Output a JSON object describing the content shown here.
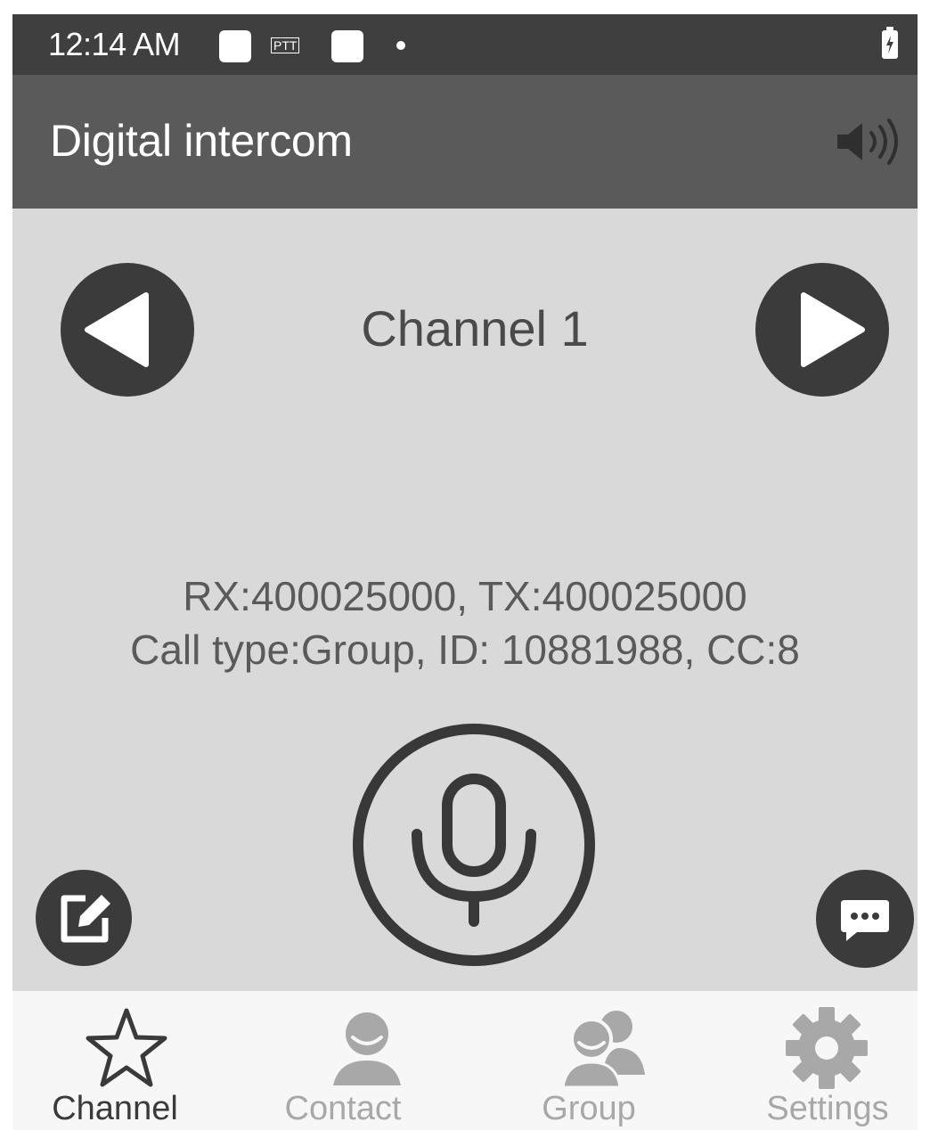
{
  "status_bar": {
    "time": "12:14 AM",
    "ptt_label": "PTT"
  },
  "app_bar": {
    "title": "Digital intercom",
    "volume_icon": "volume-icon"
  },
  "channel": {
    "name": "Channel 1",
    "prev_icon": "chevron-left-icon",
    "next_icon": "chevron-right-icon"
  },
  "info": {
    "freq_line": "RX:400025000, TX:400025000",
    "call_line": "Call type:Group, ID: 10881988, CC:8"
  },
  "actions": {
    "mic_icon": "microphone-icon",
    "edit_icon": "edit-icon",
    "message_icon": "message-icon"
  },
  "bottom_nav": {
    "tabs": [
      {
        "label": "Channel",
        "icon": "star-icon",
        "active": true
      },
      {
        "label": "Contact",
        "icon": "person-icon",
        "active": false
      },
      {
        "label": "Group",
        "icon": "group-icon",
        "active": false
      },
      {
        "label": "Settings",
        "icon": "gear-icon",
        "active": false
      }
    ]
  },
  "colors": {
    "status_bar": "#3f3f3f",
    "app_bar": "#5a5a5a",
    "content_bg": "#d9d9d9",
    "button_dark": "#3b3b3b",
    "tab_active": "#3a3a3a",
    "tab_inactive": "#a8a8a8"
  }
}
